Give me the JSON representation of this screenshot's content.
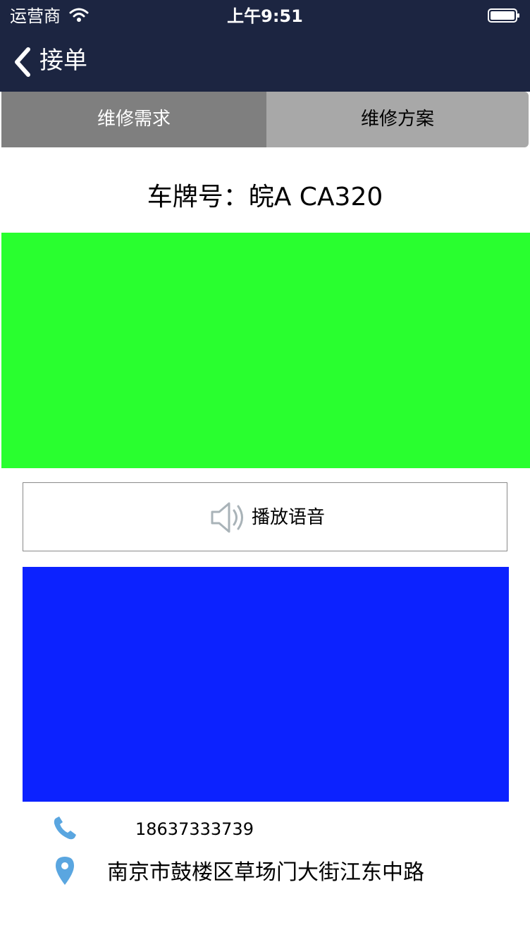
{
  "status_bar": {
    "carrier": "运营商",
    "time": "上午9:51"
  },
  "nav": {
    "title": "接单"
  },
  "tabs": [
    {
      "label": "维修需求",
      "selected": true
    },
    {
      "label": "维修方案",
      "selected": false
    }
  ],
  "plate": {
    "text": "车牌号：皖A CA320"
  },
  "colors": {
    "nav_bg": "#1c2541",
    "green_block": "#29ff2f",
    "blue_block": "#0c22ff",
    "icon_blue": "#5aa6e0"
  },
  "voice_button": {
    "label": "播放语音",
    "icon": "speaker-icon"
  },
  "contact": {
    "phone": "18637333739",
    "phone_icon": "phone-icon",
    "address": "南京市鼓楼区草场门大街江东中路",
    "address_icon": "location-pin-icon"
  }
}
